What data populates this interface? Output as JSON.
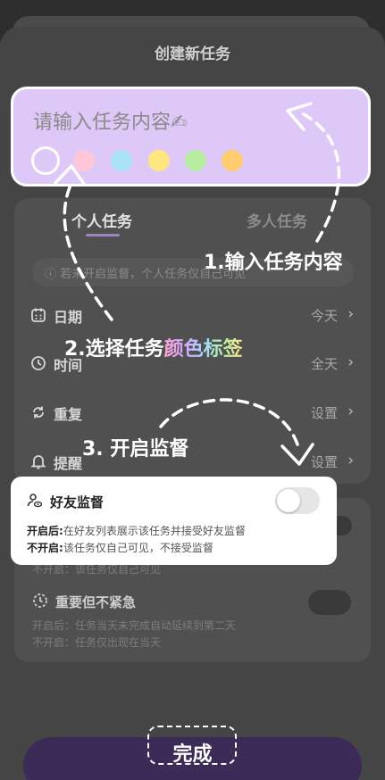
{
  "sheet": {
    "title": "创建新任务"
  },
  "task_input": {
    "placeholder": "请输入任务内容✍",
    "colors": [
      "#ddc8f7",
      "#ffc8d8",
      "#a8e4f5",
      "#ffe680",
      "#b8eca0",
      "#ffcc70"
    ],
    "selected_color_index": 0
  },
  "tabs": [
    {
      "label": "个人任务",
      "active": true
    },
    {
      "label": "多人任务",
      "active": false
    }
  ],
  "hint": "若未开启监督，个人任务仅自己可见",
  "rows": [
    {
      "label": "日期",
      "value": "今天",
      "icon": "calendar-icon"
    },
    {
      "label": "时间",
      "value": "全天",
      "icon": "clock-icon"
    },
    {
      "label": "重复",
      "value": "设置",
      "icon": "repeat-icon"
    },
    {
      "label": "提醒",
      "value": "设置",
      "icon": "bell-icon"
    }
  ],
  "friend_supervision": {
    "title": "好友监督",
    "on_label": "开启后:",
    "on_text": "在好友列表展示该任务并接受好友监督",
    "off_label": "不开启:",
    "off_text": "该任务仅自己可见，不接受监督",
    "enabled": false,
    "dim_off_text": "不开启：该任务仅自己可见"
  },
  "important_not_urgent": {
    "title": "重要但不紧急",
    "on_text": "开启后：任务当天未完成自动延续到第二天",
    "off_text": "不开启：任务仅出现在当天",
    "enabled": false
  },
  "finish_button": {
    "label": "完成"
  },
  "guides": {
    "step1": "1.输入任务内容",
    "step2_prefix": "2.选择任务",
    "step2_highlight": "颜色标签",
    "step3": "3. 开启监督"
  },
  "theme": {
    "accent": "#9a86c4",
    "button": "#3b2b56"
  }
}
